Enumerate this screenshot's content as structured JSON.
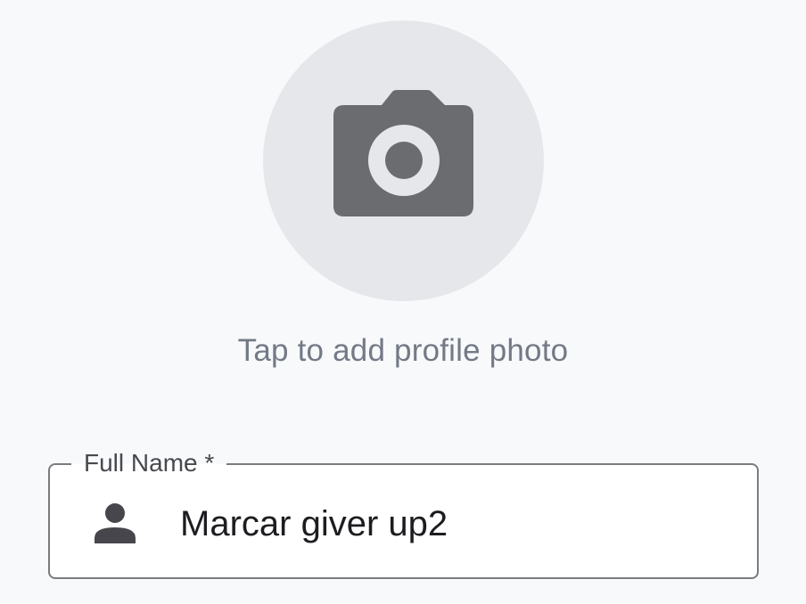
{
  "profile_photo": {
    "hint_text": "Tap to add profile photo",
    "icon": "camera-icon"
  },
  "full_name_field": {
    "label": "Full Name *",
    "value": "Marcar giver up2",
    "icon": "person-icon"
  },
  "colors": {
    "background": "#f8f9fb",
    "photo_circle": "#e6e7eb",
    "camera_icon": "#6b6c70",
    "hint_text": "#737a86",
    "field_border": "#7b7b80",
    "field_text": "#1d1d21"
  }
}
